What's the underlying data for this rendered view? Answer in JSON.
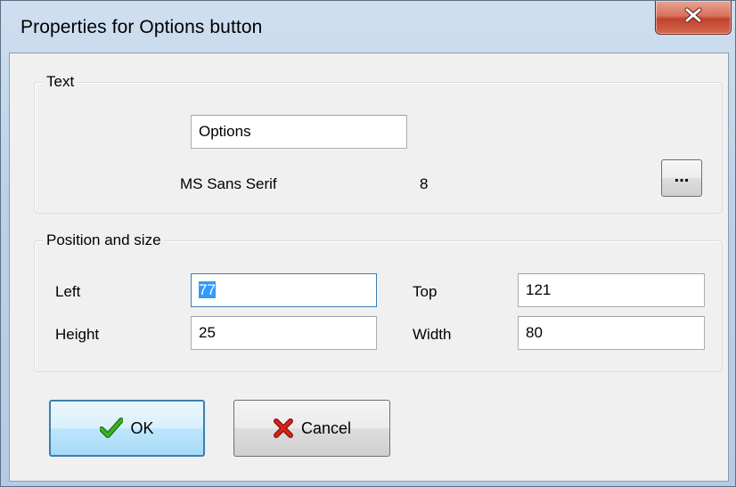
{
  "window": {
    "title": "Properties for Options button"
  },
  "text_group": {
    "label": "Text",
    "caption_value": "Options",
    "font_name": "MS Sans Serif",
    "font_size": "8",
    "font_button_label": "..."
  },
  "position_group": {
    "label": "Position and size",
    "left_label": "Left",
    "left_value": "77",
    "top_label": "Top",
    "top_value": "121",
    "height_label": "Height",
    "height_value": "25",
    "width_label": "Width",
    "width_value": "80"
  },
  "buttons": {
    "ok_label": "OK",
    "cancel_label": "Cancel"
  },
  "icons": {
    "close": "close-icon",
    "ok": "checkmark-icon",
    "cancel": "red-x-icon"
  },
  "colors": {
    "selection": "#3399ff",
    "focus_border": "#3c7fb1",
    "ok_check": "#2e9b1c",
    "cancel_x": "#c8160d",
    "close_button": "#c1432e"
  }
}
